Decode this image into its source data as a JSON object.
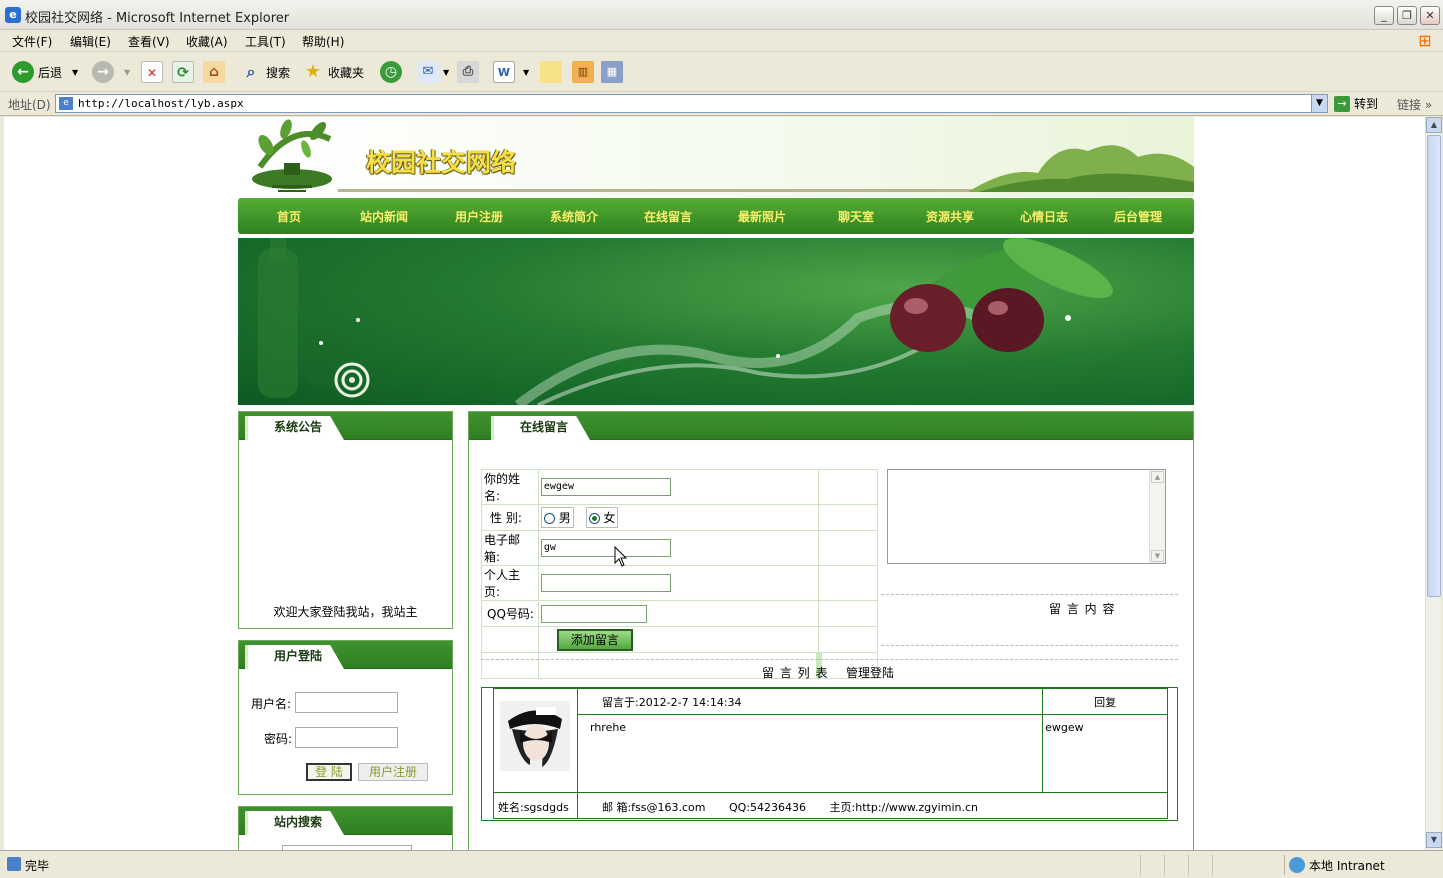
{
  "window": {
    "title": "校园社交网络 - Microsoft Internet Explorer"
  },
  "menu": [
    "文件(F)",
    "编辑(E)",
    "查看(V)",
    "收藏(A)",
    "工具(T)",
    "帮助(H)"
  ],
  "toolbar": {
    "back": "后退",
    "search": "搜索",
    "favorites": "收藏夹"
  },
  "address": {
    "label": "地址(D)",
    "url": "http://localhost/lyb.aspx",
    "go": "转到",
    "links": "链接"
  },
  "status": {
    "text": "完毕",
    "zone": "本地 Intranet"
  },
  "site": {
    "title": "校园社交网络",
    "nav": [
      "首页",
      "站内新闻",
      "用户注册",
      "系统简介",
      "在线留言",
      "最新照片",
      "聊天室",
      "资源共享",
      "心情日志",
      "后台管理"
    ]
  },
  "announce": {
    "title": "系统公告",
    "text": "欢迎大家登陆我站，我站主"
  },
  "login": {
    "title": "用户登陆",
    "user_label": "用户名:",
    "pass_label": "密码:",
    "login_btn": "登 陆",
    "register_btn": "用户注册"
  },
  "search": {
    "title": "站内搜索"
  },
  "guestbook": {
    "title": "在线留言",
    "name_label": "你的姓名:",
    "name_value": "ewgew",
    "gender_label": "性 别:",
    "gender_male": "男",
    "gender_female": "女",
    "gender_selected": "女",
    "email_label": "电子邮箱:",
    "email_value": "gw",
    "homepage_label": "个人主页:",
    "homepage_value": "",
    "qq_label": "QQ号码:",
    "qq_value": "",
    "add_btn": "添加留言",
    "content_label": "留 言 内 容",
    "list_label": "留 言 列 表",
    "admin_link": "管理登陆"
  },
  "messages": [
    {
      "posted": "留言于:2012-2-7 14:14:34",
      "reply_label": "回复",
      "content": "rhrehe",
      "reply": "ewgew",
      "name": "姓名:sgsdgds",
      "email": "邮 箱:fss@163.com",
      "qq": "QQ:54236436",
      "homepage": "主页:http://www.zgyimin.cn"
    }
  ]
}
